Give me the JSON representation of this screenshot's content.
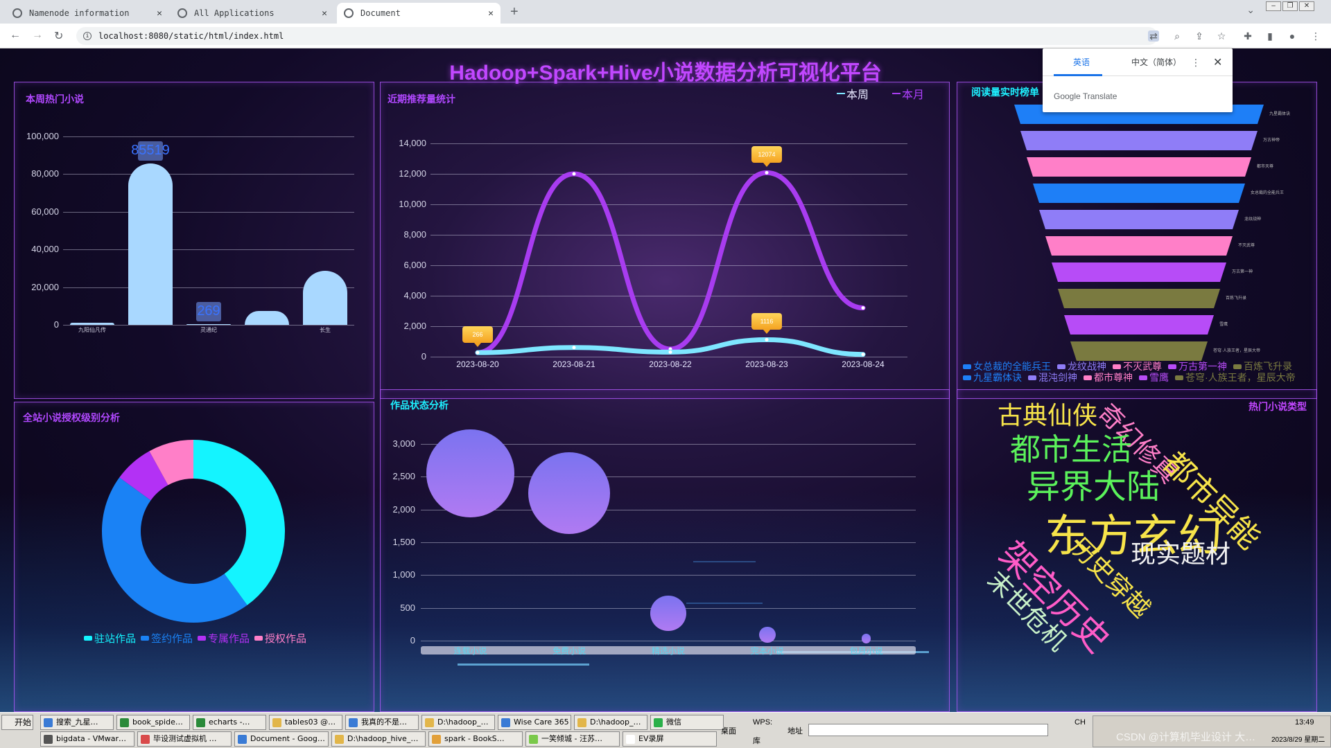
{
  "browser": {
    "tabs": [
      {
        "title": "Namenode information",
        "active": false
      },
      {
        "title": "All Applications",
        "active": false
      },
      {
        "title": "Document",
        "active": true
      }
    ],
    "url": "localhost:8080/static/html/index.html"
  },
  "translate_popup": {
    "lang_source": "英语",
    "lang_target": "中文（简体）",
    "footer": "Google Translate"
  },
  "dashboard": {
    "title": "Hadoop+Spark+Hive小说数据分析可视化平台",
    "panels": {
      "hot_novels": "本周热门小说",
      "recommend": "近期推荐量统计",
      "reading_rank": "阅读量实时榜单",
      "license": "全站小说授权级别分析",
      "status": "作品状态分析",
      "genres": "热门小说类型"
    }
  },
  "chart_data": [
    {
      "type": "bar",
      "title": "本周热门小说",
      "categories": [
        "九阳仙凡传",
        "",
        "灵通纪",
        "",
        "长生"
      ],
      "values": [
        1200,
        85519,
        269,
        7500,
        28500
      ],
      "data_labels": [
        "",
        "85519",
        "269",
        "",
        ""
      ],
      "ylim": [
        0,
        100000
      ],
      "yticks": [
        "0",
        "20,000",
        "40,000",
        "60,000",
        "80,000",
        "100,000"
      ]
    },
    {
      "type": "line",
      "title": "近期推荐量统计",
      "categories": [
        "2023-08-20",
        "2023-08-21",
        "2023-08-22",
        "2023-08-23",
        "2023-08-24"
      ],
      "series": [
        {
          "name": "本周",
          "values": [
            266,
            600,
            300,
            1116,
            150
          ],
          "color": "#7ee6ff"
        },
        {
          "name": "本月",
          "values": [
            266,
            12000,
            500,
            12074,
            3200
          ],
          "color": "#a83cf0"
        }
      ],
      "tooltips": [
        "266",
        "12074",
        "1116"
      ],
      "ylim": [
        0,
        14000
      ],
      "yticks": [
        "0",
        "2,000",
        "4,000",
        "6,000",
        "8,000",
        "10,000",
        "12,000",
        "14,000"
      ]
    },
    {
      "type": "funnel",
      "title": "阅读量实时榜单",
      "segments": [
        {
          "label": "九星霸体诀",
          "color": "#1e7ff7"
        },
        {
          "label": "万古神帝",
          "color": "#8f7df7"
        },
        {
          "label": "都市天尊",
          "color": "#ff7fc8"
        },
        {
          "label": "女总裁的全能兵王",
          "color": "#1e7ff7"
        },
        {
          "label": "龙纹战神",
          "color": "#8f7df7"
        },
        {
          "label": "不灭武尊",
          "color": "#ff7fc8"
        },
        {
          "label": "万古第一神",
          "color": "#b74cf7"
        },
        {
          "label": "百炼飞升录",
          "color": "#7a7a40"
        },
        {
          "label": "雪鹰",
          "color": "#b74cf7"
        },
        {
          "label": "苍穹·人族王者，星辰大帝",
          "color": "#7a7a40"
        }
      ],
      "legend": [
        "女总裁的全能兵王",
        "龙纹战神",
        "不灭武尊",
        "万古第一神",
        "百炼飞升录"
      ],
      "legend_row2": [
        "九星霸体诀",
        "混沌剑神",
        "都市尊神",
        "雪鹰",
        "苍穹·人族王者，星辰大帝"
      ],
      "legend_colors": [
        "#1e7ff7",
        "#8f7df7",
        "#ff7fc8",
        "#b74cf7",
        "#7a7a40"
      ]
    },
    {
      "type": "pie",
      "title": "全站小说授权级别分析",
      "categories": [
        "驻站作品",
        "签约作品",
        "专属作品",
        "授权作品"
      ],
      "values": [
        40,
        45,
        7,
        8
      ],
      "colors": [
        "#14f4ff",
        "#1a82f5",
        "#b331f5",
        "#ff7fc8"
      ]
    },
    {
      "type": "scatter",
      "title": "作品状态分析",
      "categories": [
        "连载小说",
        "免费小说",
        "精选小说",
        "完本小说",
        "包月小说"
      ],
      "values": [
        2550,
        2250,
        420,
        90,
        30
      ],
      "ylim": [
        0,
        3000
      ],
      "yticks": [
        "0",
        "500",
        "1,000",
        "1,500",
        "2,000",
        "2,500",
        "3,000"
      ]
    }
  ],
  "wordcloud": [
    {
      "text": "古典仙侠",
      "color": "#f7e44a"
    },
    {
      "text": "奇幻修真",
      "color": "#ff7fc8"
    },
    {
      "text": "都市生活",
      "color": "#5bf25b"
    },
    {
      "text": "都市异能",
      "color": "#f7e44a"
    },
    {
      "text": "异界大陆",
      "color": "#5bf25b"
    },
    {
      "text": "东方玄幻",
      "color": "#f7e44a"
    },
    {
      "text": "现实题材",
      "color": "#f2f2f2"
    },
    {
      "text": "历史穿越",
      "color": "#f7e44a"
    },
    {
      "text": "架空历史",
      "color": "#ff5cc8"
    },
    {
      "text": "末世危机",
      "color": "#c9f2c9"
    }
  ],
  "taskbar": {
    "start": "开始",
    "row1": [
      "搜索_九星…",
      "book_spide…",
      "echarts -…",
      "tables03 @…",
      "我真的不是…",
      "D:\\hadoop_…",
      "Wise Care 365",
      "D:\\hadoop_…",
      "微信"
    ],
    "row2": [
      "bigdata - VMwar…",
      "毕设测试虚拟机 …",
      "Document - Goog…",
      "D:\\hadoop_hive_…",
      "spark - BookS…",
      "一笑倾城 - 汪苏…",
      "EV录屏"
    ],
    "desktop": "桌面",
    "wps": "WPS:",
    "lib": "库",
    "address": "地址",
    "ime": "CH",
    "clock": "13:49",
    "date": "2023/8/29 星期二",
    "watermark": "CSDN @计算机毕业设计 大…"
  }
}
